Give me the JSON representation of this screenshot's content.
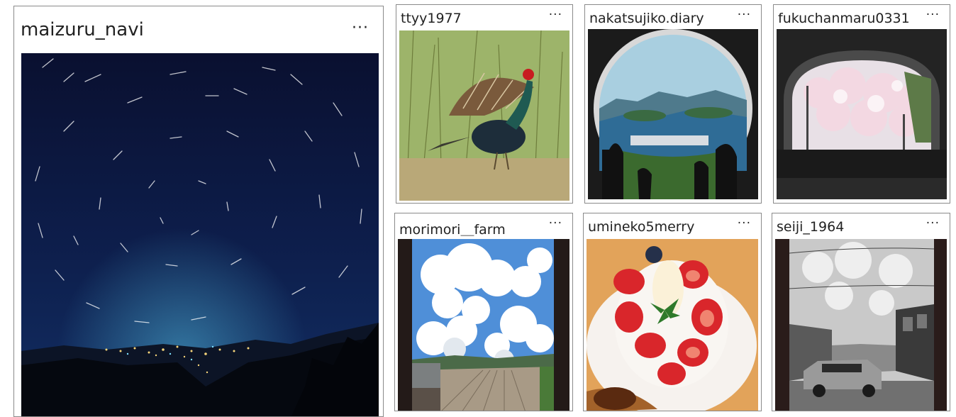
{
  "posts": [
    {
      "username": "maizuru_navi",
      "more": "···"
    },
    {
      "username": "ttyy1977",
      "more": "···"
    },
    {
      "username": "nakatsujiko.diary",
      "more": "···"
    },
    {
      "username": "fukuchanmaru0331",
      "more": "···"
    },
    {
      "username": "morimori＿farm",
      "more": "···"
    },
    {
      "username": "umineko5merry",
      "more": "···"
    },
    {
      "username": "seiji_1964",
      "more": "···"
    }
  ]
}
